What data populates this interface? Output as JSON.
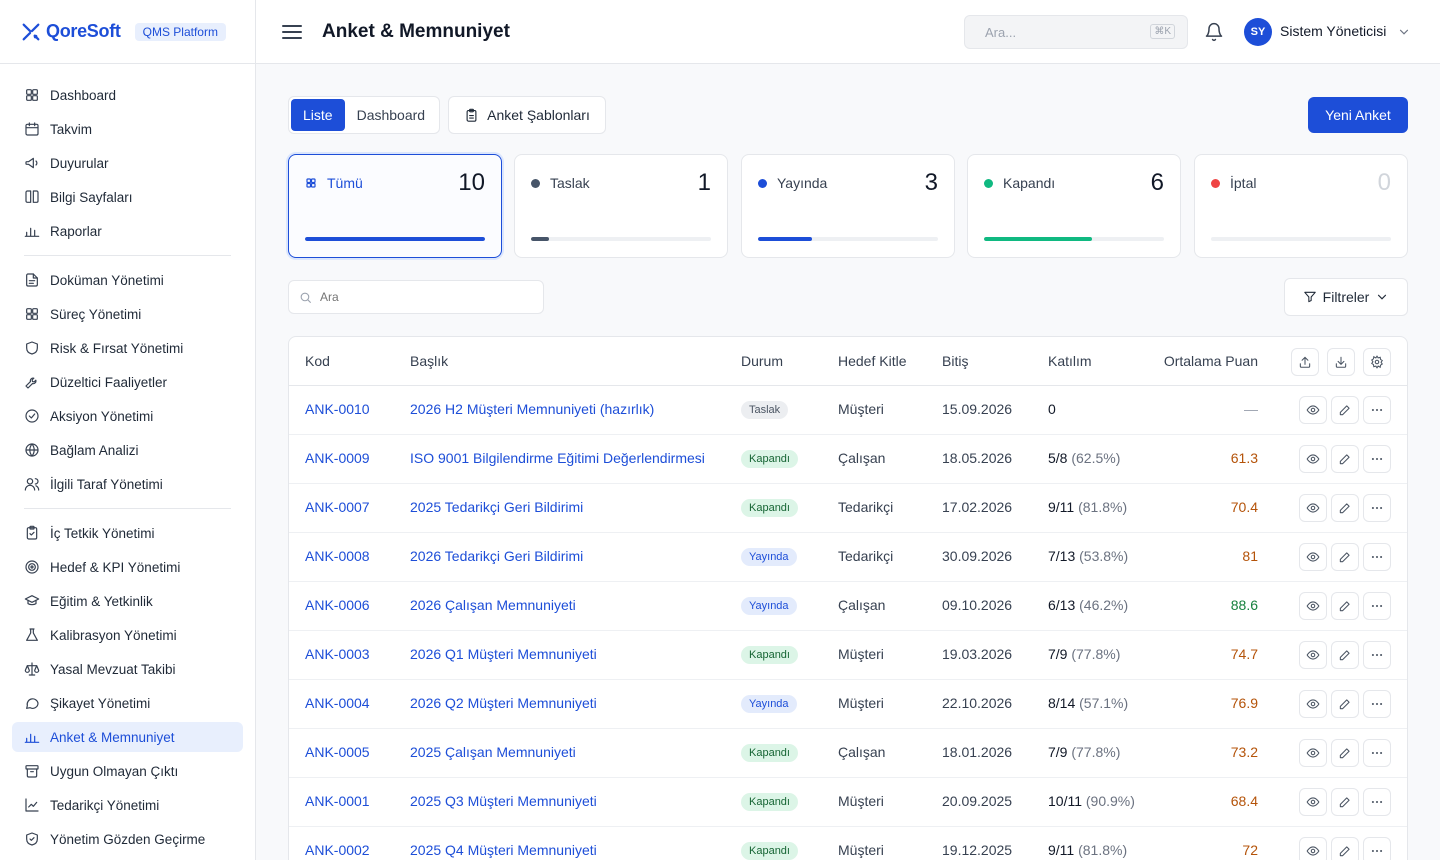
{
  "brand": {
    "name": "QoreSoft",
    "badge": "QMS Platform"
  },
  "sidebar": {
    "groups": [
      [
        {
          "label": "Dashboard",
          "icon": "grid-icon"
        },
        {
          "label": "Takvim",
          "icon": "calendar-icon"
        },
        {
          "label": "Duyurular",
          "icon": "megaphone-icon"
        },
        {
          "label": "Bilgi Sayfaları",
          "icon": "book-icon"
        },
        {
          "label": "Raporlar",
          "icon": "bar-chart-icon"
        }
      ],
      [
        {
          "label": "Doküman Yönetimi",
          "icon": "document-icon"
        },
        {
          "label": "Süreç Yönetimi",
          "icon": "grid-icon"
        },
        {
          "label": "Risk & Fırsat Yönetimi",
          "icon": "shield-icon"
        },
        {
          "label": "Düzeltici Faaliyetler",
          "icon": "wrench-icon"
        },
        {
          "label": "Aksiyon Yönetimi",
          "icon": "check-circle-icon"
        },
        {
          "label": "Bağlam Analizi",
          "icon": "globe-icon"
        },
        {
          "label": "İlgili Taraf Yönetimi",
          "icon": "users-icon"
        }
      ],
      [
        {
          "label": "İç Tetkik Yönetimi",
          "icon": "clipboard-check-icon"
        },
        {
          "label": "Hedef & KPI Yönetimi",
          "icon": "target-icon"
        },
        {
          "label": "Eğitim & Yetkinlik",
          "icon": "graduation-cap-icon"
        },
        {
          "label": "Kalibrasyon Yönetimi",
          "icon": "flask-icon"
        },
        {
          "label": "Yasal Mevzuat Takibi",
          "icon": "scale-icon"
        },
        {
          "label": "Şikayet Yönetimi",
          "icon": "message-icon"
        },
        {
          "label": "Anket & Memnuniyet",
          "icon": "bar-chart-icon",
          "active": true
        },
        {
          "label": "Uygun Olmayan Çıktı",
          "icon": "archive-icon"
        },
        {
          "label": "Tedarikçi Yönetimi",
          "icon": "line-chart-icon"
        },
        {
          "label": "Yönetim Gözden Geçirme",
          "icon": "shield-check-icon"
        }
      ]
    ]
  },
  "topbar": {
    "title": "Anket & Memnuniyet",
    "search_placeholder": "Ara...",
    "shortcut": "⌘K",
    "user_initials": "SY",
    "user_name": "Sistem Yöneticisi"
  },
  "toolbar": {
    "view_list": "Liste",
    "view_dashboard": "Dashboard",
    "templates": "Anket Şablonları",
    "new_survey": "Yeni Anket"
  },
  "stats": [
    {
      "label": "Tümü",
      "value": "10",
      "fraction": 1.0,
      "color": "#1d4ed8",
      "active": true
    },
    {
      "label": "Taslak",
      "value": "1",
      "fraction": 0.1,
      "color": "#475569"
    },
    {
      "label": "Yayında",
      "value": "3",
      "fraction": 0.3,
      "color": "#1d4ed8"
    },
    {
      "label": "Kapandı",
      "value": "6",
      "fraction": 0.6,
      "color": "#10b981"
    },
    {
      "label": "İptal",
      "value": "0",
      "fraction": 0.0,
      "color": "#ef4444"
    }
  ],
  "list": {
    "search_placeholder": "Ara",
    "filters": "Filtreler"
  },
  "table": {
    "headers": {
      "code": "Kod",
      "title": "Başlık",
      "status": "Durum",
      "audience": "Hedef Kitle",
      "end": "Bitiş",
      "participation": "Katılım",
      "score": "Ortalama Puan"
    },
    "rows": [
      {
        "code": "ANK-0010",
        "title": "2026 H2 Müşteri Memnuniyeti (hazırlık)",
        "status": "Taslak",
        "status_key": "taslak",
        "audience": "Müşteri",
        "end": "15.09.2026",
        "participation": "0",
        "pct": "",
        "score": "—",
        "score_tone": "dash"
      },
      {
        "code": "ANK-0009",
        "title": "ISO 9001 Bilgilendirme Eğitimi Değerlendirmesi",
        "status": "Kapandı",
        "status_key": "kapandi",
        "audience": "Çalışan",
        "end": "18.05.2026",
        "participation": "5/8",
        "pct": "(62.5%)",
        "score": "61.3",
        "score_tone": "amber"
      },
      {
        "code": "ANK-0007",
        "title": "2025 Tedarikçi Geri Bildirimi",
        "status": "Kapandı",
        "status_key": "kapandi",
        "audience": "Tedarikçi",
        "end": "17.02.2026",
        "participation": "9/11",
        "pct": "(81.8%)",
        "score": "70.4",
        "score_tone": "amber"
      },
      {
        "code": "ANK-0008",
        "title": "2026 Tedarikçi Geri Bildirimi",
        "status": "Yayında",
        "status_key": "yayinda",
        "audience": "Tedarikçi",
        "end": "30.09.2026",
        "participation": "7/13",
        "pct": "(53.8%)",
        "score": "81",
        "score_tone": "amber"
      },
      {
        "code": "ANK-0006",
        "title": "2026 Çalışan Memnuniyeti",
        "status": "Yayında",
        "status_key": "yayinda",
        "audience": "Çalışan",
        "end": "09.10.2026",
        "participation": "6/13",
        "pct": "(46.2%)",
        "score": "88.6",
        "score_tone": "green"
      },
      {
        "code": "ANK-0003",
        "title": "2026 Q1 Müşteri Memnuniyeti",
        "status": "Kapandı",
        "status_key": "kapandi",
        "audience": "Müşteri",
        "end": "19.03.2026",
        "participation": "7/9",
        "pct": "(77.8%)",
        "score": "74.7",
        "score_tone": "amber"
      },
      {
        "code": "ANK-0004",
        "title": "2026 Q2 Müşteri Memnuniyeti",
        "status": "Yayında",
        "status_key": "yayinda",
        "audience": "Müşteri",
        "end": "22.10.2026",
        "participation": "8/14",
        "pct": "(57.1%)",
        "score": "76.9",
        "score_tone": "amber"
      },
      {
        "code": "ANK-0005",
        "title": "2025 Çalışan Memnuniyeti",
        "status": "Kapandı",
        "status_key": "kapandi",
        "audience": "Çalışan",
        "end": "18.01.2026",
        "participation": "7/9",
        "pct": "(77.8%)",
        "score": "73.2",
        "score_tone": "amber"
      },
      {
        "code": "ANK-0001",
        "title": "2025 Q3 Müşteri Memnuniyeti",
        "status": "Kapandı",
        "status_key": "kapandi",
        "audience": "Müşteri",
        "end": "20.09.2025",
        "participation": "10/11",
        "pct": "(90.9%)",
        "score": "68.4",
        "score_tone": "amber"
      },
      {
        "code": "ANK-0002",
        "title": "2025 Q4 Müşteri Memnuniyeti",
        "status": "Kapandı",
        "status_key": "kapandi",
        "audience": "Müşteri",
        "end": "19.12.2025",
        "participation": "9/11",
        "pct": "(81.8%)",
        "score": "72",
        "score_tone": "amber"
      }
    ]
  }
}
